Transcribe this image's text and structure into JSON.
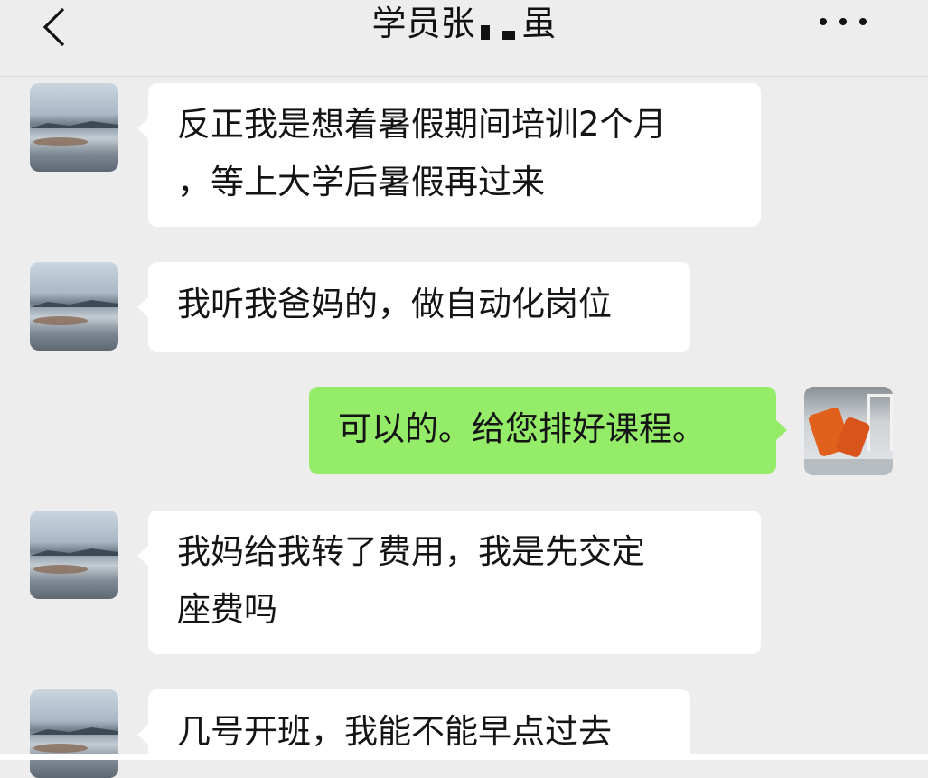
{
  "header": {
    "back_icon": "chevron-left-icon",
    "title_prefix": "学员张",
    "title_suffix": "虽",
    "more_icon": "more-horizontal-icon"
  },
  "messages": [
    {
      "side": "left",
      "avatar": "lake-avatar",
      "lines": [
        "反正我是想着暑假期间培训2个月",
        "，等上大学后暑假再过来"
      ]
    },
    {
      "side": "left",
      "avatar": "lake-avatar",
      "lines": [
        "我听我爸妈的，做自动化岗位"
      ]
    },
    {
      "side": "right",
      "avatar": "robot-avatar",
      "lines": [
        "可以的。给您排好课程。"
      ]
    },
    {
      "side": "left",
      "avatar": "lake-avatar",
      "lines": [
        "我妈给我转了费用，我是先交定",
        "座费吗"
      ]
    },
    {
      "side": "left",
      "avatar": "lake-avatar",
      "lines": [
        "几号开班，我能不能早点过去"
      ]
    }
  ],
  "colors": {
    "background": "#ededed",
    "incoming_bubble": "#ffffff",
    "outgoing_bubble": "#95ec69"
  }
}
